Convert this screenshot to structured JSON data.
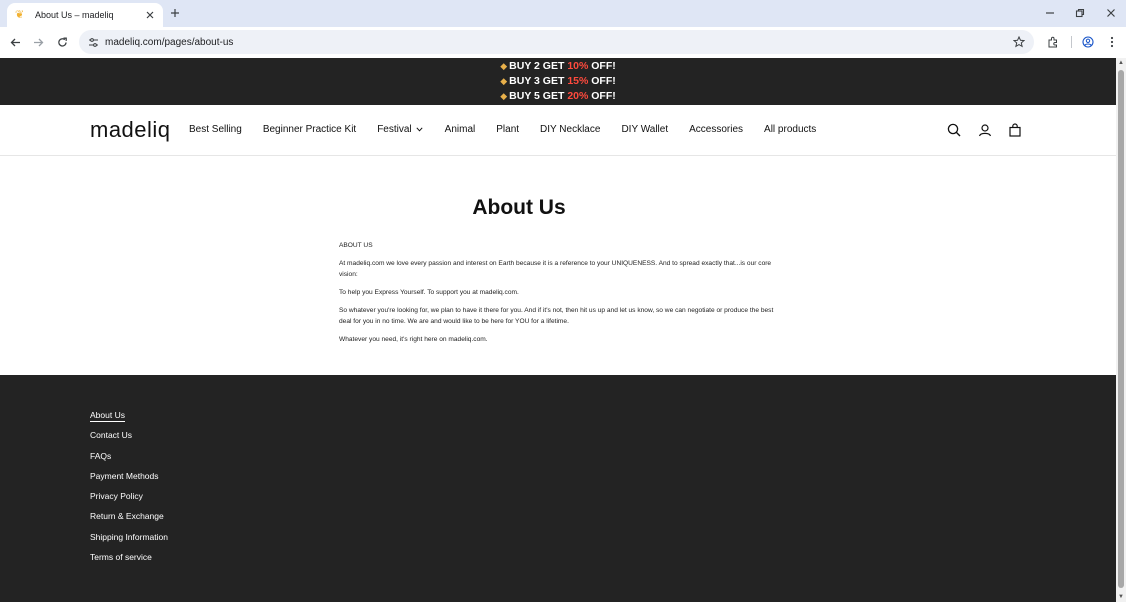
{
  "browser": {
    "tab_title": "About Us – madeliq",
    "url": "madeliq.com/pages/about-us"
  },
  "announcement": {
    "lines": [
      {
        "prefix": "BUY 2 GET ",
        "percent": "10%",
        "suffix": " OFF!"
      },
      {
        "prefix": "BUY 3 GET ",
        "percent": "15%",
        "suffix": " OFF!"
      },
      {
        "prefix": "BUY 5 GET ",
        "percent": "20%",
        "suffix": " OFF!"
      }
    ],
    "icon": "price-tag-icon"
  },
  "header": {
    "logo": "madeliq",
    "nav": [
      {
        "label": "Best Selling"
      },
      {
        "label": "Beginner Practice Kit"
      },
      {
        "label": "Festival"
      },
      {
        "label": "Animal"
      },
      {
        "label": "Plant"
      },
      {
        "label": "DIY Necklace"
      },
      {
        "label": "DIY Wallet"
      },
      {
        "label": "Accessories"
      },
      {
        "label": "All products"
      }
    ]
  },
  "main": {
    "title": "About Us",
    "heading": "ABOUT US",
    "paragraphs": [
      "At madeliq.com  we love every passion and interest on Earth because it is a reference to your UNIQUENESS. And to spread exactly that...is our core vision:",
      "To help you Express Yourself. To support you at madeliq.com.",
      "So whatever you're looking for, we plan to have it there for you. And if it's not, then hit us up and let us know, so we can negotiate or produce the best deal for you in no time. We are and would like to be here for YOU for a lifetime.",
      "Whatever you need, it's right here on madeliq.com."
    ]
  },
  "footer": {
    "links": [
      {
        "label": "About Us"
      },
      {
        "label": "Contact Us"
      },
      {
        "label": "FAQs"
      },
      {
        "label": "Payment Methods"
      },
      {
        "label": "Privacy Policy"
      },
      {
        "label": "Return & Exchange"
      },
      {
        "label": "Shipping Information"
      },
      {
        "label": "Terms of service"
      }
    ]
  },
  "colors": {
    "announce_bg": "#232323",
    "discount_red": "#ff4a3d",
    "tag_gold": "#e8b04a",
    "footer_bg": "#232323",
    "chrome_tabbar": "#dfe6f5"
  }
}
